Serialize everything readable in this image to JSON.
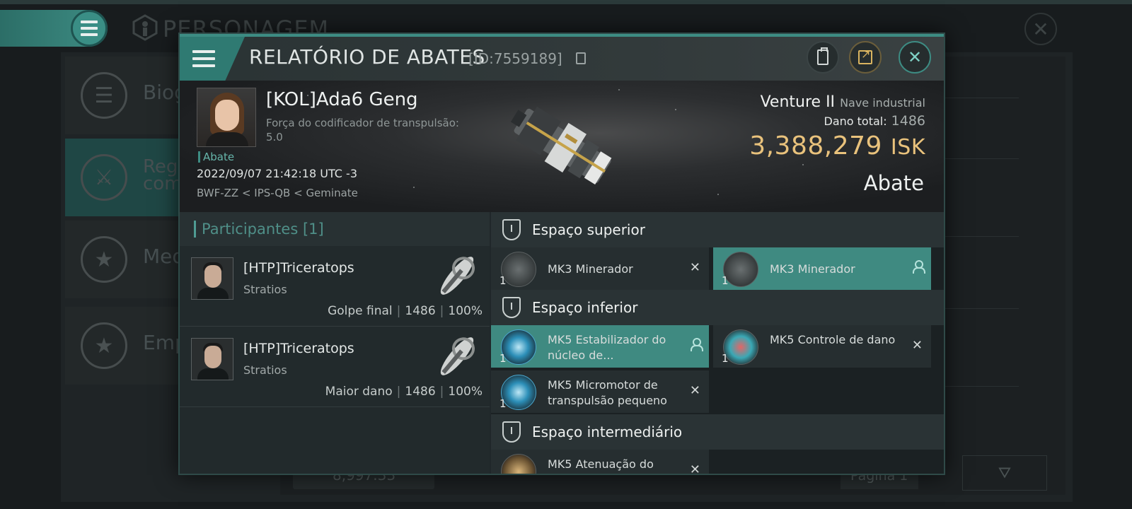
{
  "background": {
    "title": "PERSONAGEM",
    "sidebar": [
      {
        "label": "Biog",
        "icon": "list-icon"
      },
      {
        "label": "Regis\ncom",
        "icon": "crossed-swords-icon"
      },
      {
        "label": "Meda",
        "icon": "medal-star-icon"
      },
      {
        "label": "Emp",
        "icon": "corporation-star-icon"
      }
    ],
    "footer": {
      "isk": "8,997.33",
      "page": "Página 1"
    }
  },
  "dialog": {
    "title": "RELATÓRIO DE ABATES",
    "id": "[ID:7559189]",
    "victim": {
      "name": "[KOL]Ada6 Geng",
      "stat_label": "Força do codificador de transpulsão:",
      "stat_value": "5.0",
      "tag": "Abate",
      "datetime": "2022/09/07 21:42:18 UTC -3",
      "location": "BWF-ZZ < IPS-QB < Geminate"
    },
    "ship": {
      "name": "Venture II",
      "class": "Nave industrial",
      "damage_label": "Dano total:",
      "damage_value": "1486",
      "isk_value": "3,388,279",
      "isk_unit": "ISK",
      "kill_type": "Abate"
    },
    "participants": {
      "title": "Participantes",
      "count": "[1]",
      "rows": [
        {
          "name": "[HTP]Triceratops",
          "ship": "Stratios",
          "role": "Golpe final",
          "damage": "1486",
          "percent": "100%"
        },
        {
          "name": "[HTP]Triceratops",
          "ship": "Stratios",
          "role": "Maior dano",
          "damage": "1486",
          "percent": "100%"
        }
      ]
    },
    "fitting": {
      "high": {
        "title": "Espaço superior",
        "modules": [
          {
            "name": "MK3 Minerador",
            "qty": "1",
            "status": "destroyed"
          },
          {
            "name": "MK3 Minerador",
            "qty": "1",
            "status": "dropped"
          }
        ]
      },
      "low": {
        "title": "Espaço inferior",
        "modules": [
          {
            "name": "MK5 Estabilizador do núcleo de...",
            "qty": "1",
            "status": "dropped"
          },
          {
            "name": "MK5 Controle de dano",
            "qty": "1",
            "status": "destroyed"
          },
          {
            "name": "MK5 Micromotor de transpulsão pequeno",
            "qty": "1",
            "status": "destroyed"
          }
        ]
      },
      "mid": {
        "title": "Espaço intermediário",
        "modules": [
          {
            "name": "MK5 Atenuação do",
            "qty": "1",
            "status": "destroyed"
          }
        ]
      }
    }
  }
}
